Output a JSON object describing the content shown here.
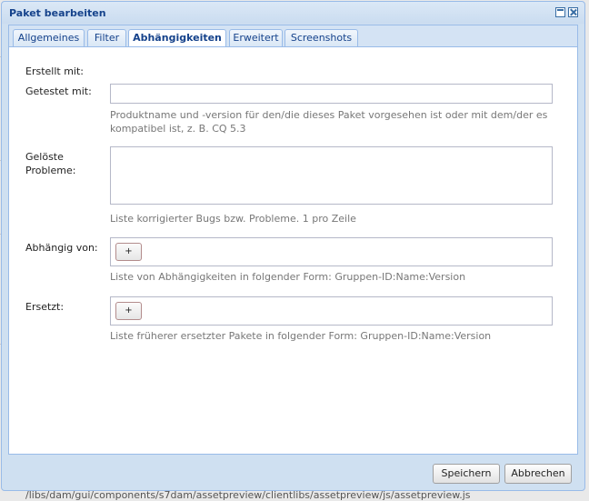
{
  "window": {
    "title": "Paket bearbeiten"
  },
  "tabs": [
    {
      "label": "Allgemeines"
    },
    {
      "label": "Filter"
    },
    {
      "label": "Abhängigkeiten"
    },
    {
      "label": "Erweitert"
    },
    {
      "label": "Screenshots"
    }
  ],
  "active_tab": "Abhängigkeiten",
  "form": {
    "created_with_label": "Erstellt mit:",
    "tested_with_label": "Getestet mit:",
    "tested_with_value": "",
    "tested_with_hint": "Produktname und -version für den/die dieses Paket vorgesehen ist oder mit dem/der es kompatibel ist, z. B. CQ 5.3",
    "fixed_issues_label": "Gelöste Probleme:",
    "fixed_issues_value": "",
    "fixed_issues_hint": "Liste korrigierter Bugs bzw. Probleme. 1 pro Zeile",
    "depends_on_label": "Abhängig von:",
    "depends_on_add": "+",
    "depends_on_hint": "Liste von Abhängigkeiten in folgender Form: Gruppen-ID:Name:Version",
    "replaces_label": "Ersetzt:",
    "replaces_add": "+",
    "replaces_hint": "Liste früherer ersetzter Pakete in folgender Form: Gruppen-ID:Name:Version"
  },
  "buttons": {
    "save": "Speichern",
    "cancel": "Abbrechen"
  },
  "background": {
    "path_text": "/libs/dam/gui/components/s7dam/assetpreview/clientlibs/assetpreview/js/assetpreview.js"
  }
}
